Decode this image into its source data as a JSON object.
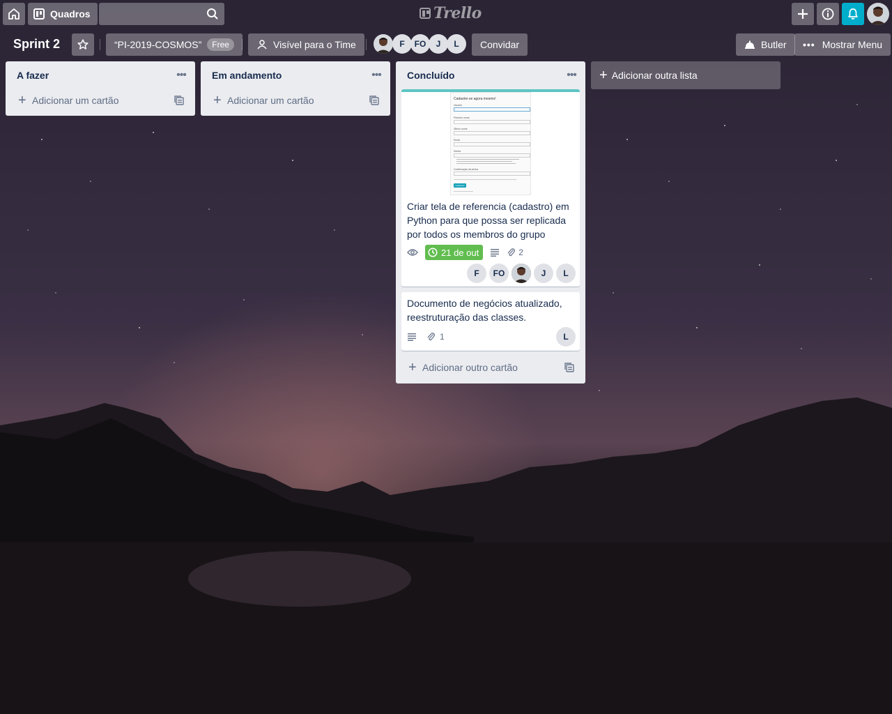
{
  "header": {
    "home_icon": "home-icon",
    "boards_label": "Quadros",
    "search_placeholder": "",
    "logo": "Trello"
  },
  "board": {
    "title": "Sprint 2",
    "team_name": "“PI-2019-COSMOS”",
    "team_badge": "Free",
    "visibility": "Visível para o Time",
    "members": [
      "F",
      "FO",
      "J",
      "L"
    ],
    "invite": "Convidar",
    "butler": "Butler",
    "menu": "Mostrar Menu"
  },
  "lists": [
    {
      "title": "A fazer",
      "add_card": "Adicionar um cartão"
    },
    {
      "title": "Em andamento",
      "add_card": "Adicionar um cartão"
    },
    {
      "title": "Concluído",
      "add_card": "Adicionar outro cartão",
      "cards": [
        {
          "text": "Criar tela de referencia (cadastro) em Python para que possa ser replicada por todos os membros do grupo",
          "due": "21 de out",
          "attachments": "2",
          "members": [
            "F",
            "FO",
            "J",
            "L"
          ],
          "preview": {
            "heading": "Cadastre-se agora mesmo!",
            "fields": [
              "Usuário",
              "Primeiro nome",
              "Último nome",
              "Email",
              "Senha",
              "Confirmação da senha"
            ],
            "button": "Cadastrar"
          }
        },
        {
          "text": "Documento de negócios atualizado, reestruturação das classes.",
          "attachments": "1",
          "members": [
            "L"
          ]
        }
      ]
    }
  ],
  "add_list": "Adicionar outra lista",
  "colors": {
    "list_bg": "#ebecf0",
    "due_green": "#61bd4f",
    "notification_blue": "#00aecc",
    "cover_teal": "#5fc4c4"
  }
}
